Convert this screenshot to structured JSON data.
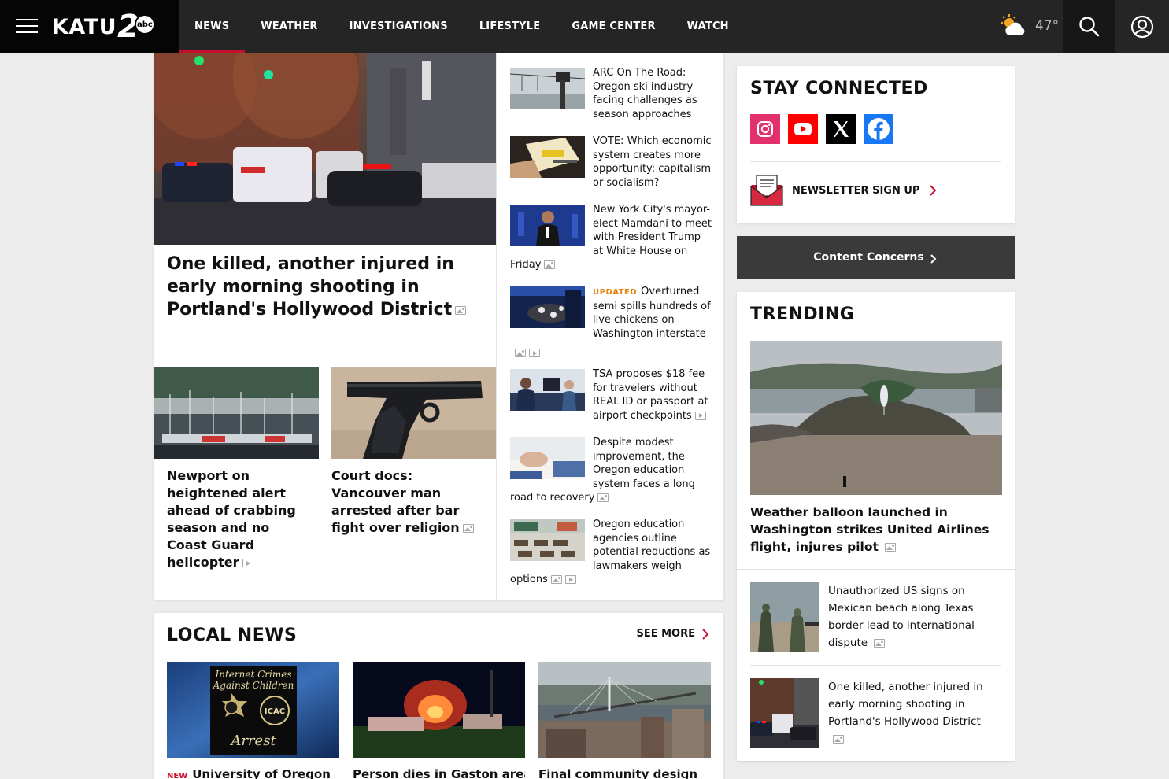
{
  "header": {
    "logo_text": "KATU",
    "logo_number": "2",
    "logo_network": "abc",
    "nav": [
      "NEWS",
      "WEATHER",
      "INVESTIGATIONS",
      "LIFESTYLE",
      "GAME CENTER",
      "WATCH"
    ],
    "active_nav": "NEWS",
    "weather_temp": "47°",
    "weather_icon": "partly-cloudy-icon"
  },
  "hero": {
    "headline": "One killed, another injured in early morning shooting in Portland's Hollywood District"
  },
  "sub_stories": [
    {
      "headline": "Newport on heightened alert ahead of crabbing season and no Coast Guard helicopter",
      "icon": "video"
    },
    {
      "headline": "Court docs: Vancouver man arrested after bar fight over religion",
      "icon": "gallery"
    }
  ],
  "side_stories": [
    {
      "tag": "",
      "headline": "ARC On The Road: Oregon ski industry facing challenges as season approaches",
      "icons": []
    },
    {
      "tag": "",
      "headline": "VOTE: Which economic system creates more opportunity: capitalism or socialism?",
      "icons": []
    },
    {
      "tag": "",
      "headline": "New York City's mayor-elect Mamdani to meet with President Trump at White House on Friday",
      "icons": [
        "gallery"
      ]
    },
    {
      "tag": "UPDATED",
      "headline": "Overturned semi spills hundreds of live chickens on Washington interstate",
      "icons": [
        "gallery",
        "video"
      ]
    },
    {
      "tag": "",
      "headline": "TSA proposes $18 fee for travelers without REAL ID or passport at airport checkpoints",
      "icons": [
        "video"
      ]
    },
    {
      "tag": "",
      "headline": "Despite modest improvement, the Oregon education system faces a long road to recovery",
      "icons": [
        "gallery"
      ]
    },
    {
      "tag": "",
      "headline": "Oregon education agencies outline potential reductions as lawmakers weigh options",
      "icons": [
        "gallery",
        "video"
      ]
    }
  ],
  "local_news": {
    "title": "LOCAL NEWS",
    "see_more": "SEE MORE",
    "items": [
      {
        "tag": "NEW",
        "headline": "University of Oregon",
        "image_caption_lines": [
          "Internet Crimes",
          "Against Children"
        ],
        "badge": "ICAC",
        "banner": "Arrest"
      },
      {
        "tag": "",
        "headline": "Person dies in Gaston area"
      },
      {
        "tag": "",
        "headline": "Final community design"
      }
    ]
  },
  "stay_connected": {
    "title": "STAY CONNECTED",
    "socials": [
      "instagram-icon",
      "youtube-icon",
      "x-icon",
      "facebook-icon"
    ],
    "newsletter_label": "NEWSLETTER SIGN UP"
  },
  "content_concerns": "Content Concerns",
  "trending": {
    "title": "TRENDING",
    "main_headline": "Weather balloon launched in Washington strikes United Airlines flight, injures pilot",
    "items": [
      {
        "headline": "Unauthorized US signs on Mexican beach along Texas border lead to international dispute"
      },
      {
        "headline": "One killed, another injured in early morning shooting in Portland's Hollywood District"
      }
    ]
  },
  "colors": {
    "accent": "#c8102e",
    "updated": "#e0820e",
    "header_bg": "#252525"
  }
}
